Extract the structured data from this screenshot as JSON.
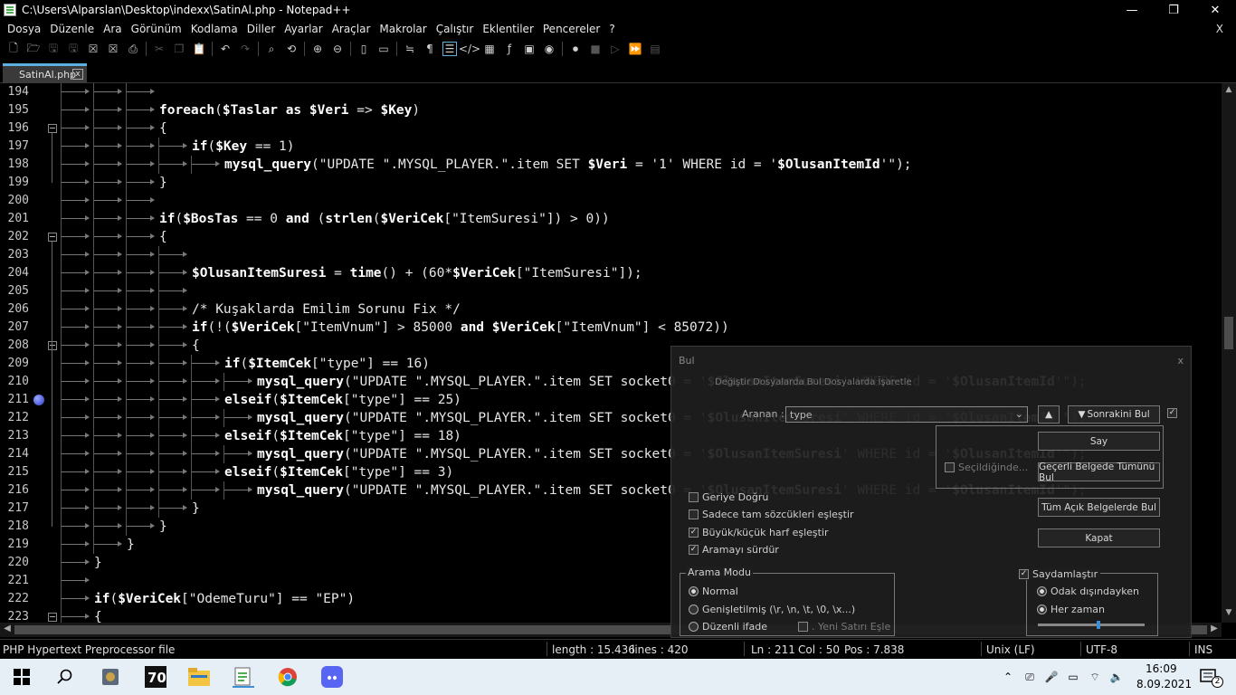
{
  "window": {
    "title": "C:\\Users\\Alparslan\\Desktop\\indexx\\SatinAl.php - Notepad++",
    "min": "—",
    "max": "❐",
    "close": "✕"
  },
  "menu": {
    "items": [
      "Dosya",
      "Düzenle",
      "Ara",
      "Görünüm",
      "Kodlama",
      "Diller",
      "Ayarlar",
      "Araçlar",
      "Makrolar",
      "Çalıştır",
      "Eklentiler",
      "Pencereler",
      "?"
    ],
    "close": "X"
  },
  "toolbar": {
    "icons": [
      "new-file-icon",
      "open-file-icon",
      "save-icon",
      "save-all-icon",
      "close-icon",
      "close-all-icon",
      "print-icon",
      "cut-icon",
      "copy-icon",
      "paste-icon",
      "undo-icon",
      "redo-icon",
      "find-icon",
      "replace-icon",
      "zoom-in-icon",
      "zoom-out-icon",
      "sync-vertical-icon",
      "sync-horizontal-icon",
      "word-wrap-icon",
      "show-all-chars-icon",
      "indent-guide-icon",
      "xml-icon",
      "doc-map-icon",
      "function-list-icon",
      "monitor-icon",
      "folder-workspace-icon",
      "record-macro-icon",
      "stop-macro-icon",
      "play-macro-icon",
      "run-macro-multiple-icon",
      "save-macro-icon"
    ]
  },
  "tab": {
    "label": "SatinAl.php",
    "close": "x"
  },
  "editor": {
    "lines": [
      {
        "n": "194",
        "indent": 3,
        "code": ""
      },
      {
        "n": "195",
        "indent": 3,
        "code": "foreach($Taslar as $Veri => $Key)"
      },
      {
        "n": "196",
        "indent": 3,
        "code": "{"
      },
      {
        "n": "197",
        "indent": 4,
        "code": "if($Key == 1)"
      },
      {
        "n": "198",
        "indent": 5,
        "code": "mysql_query(\"UPDATE \".MYSQL_PLAYER.\".item SET $Veri = '1' WHERE id = '$OlusanItemId'\");"
      },
      {
        "n": "199",
        "indent": 3,
        "code": "}"
      },
      {
        "n": "200",
        "indent": 3,
        "code": ""
      },
      {
        "n": "201",
        "indent": 3,
        "code": "if($BosTas == 0 and (strlen($VeriCek[\"ItemSuresi\"]) > 0))"
      },
      {
        "n": "202",
        "indent": 3,
        "code": "{"
      },
      {
        "n": "203",
        "indent": 4,
        "code": ""
      },
      {
        "n": "204",
        "indent": 4,
        "code": "$OlusanItemSuresi = time() + (60*$VeriCek[\"ItemSuresi\"]);"
      },
      {
        "n": "205",
        "indent": 4,
        "code": ""
      },
      {
        "n": "206",
        "indent": 4,
        "code": "/* Kuşaklarda Emilim Sorunu Fix */"
      },
      {
        "n": "207",
        "indent": 4,
        "code": "if(!($VeriCek[\"ItemVnum\"] > 85000 and $VeriCek[\"ItemVnum\"] < 85072))"
      },
      {
        "n": "208",
        "indent": 4,
        "code": "{"
      },
      {
        "n": "209",
        "indent": 5,
        "code": "if($ItemCek[\"type\"] == 16)"
      },
      {
        "n": "210",
        "indent": 6,
        "code": "mysql_query(\"UPDATE \".MYSQL_PLAYER.\".item SET socket0 = '$OlusanItemSuresi' WHERE id = '$OlusanItemId'\");"
      },
      {
        "n": "211",
        "indent": 5,
        "code": "elseif($ItemCek[\"type\"] == 25)"
      },
      {
        "n": "212",
        "indent": 6,
        "code": "mysql_query(\"UPDATE \".MYSQL_PLAYER.\".item SET socket0 = '$OlusanItemSuresi' WHERE id = '$OlusanItemId'\");"
      },
      {
        "n": "213",
        "indent": 5,
        "code": "elseif($ItemCek[\"type\"] == 18)"
      },
      {
        "n": "214",
        "indent": 6,
        "code": "mysql_query(\"UPDATE \".MYSQL_PLAYER.\".item SET socket0 = '$OlusanItemSuresi' WHERE id = '$OlusanItemId'\");"
      },
      {
        "n": "215",
        "indent": 5,
        "code": "elseif($ItemCek[\"type\"] == 3)"
      },
      {
        "n": "216",
        "indent": 6,
        "code": "mysql_query(\"UPDATE \".MYSQL_PLAYER.\".item SET socket0 = '$OlusanItemSuresi' WHERE id = '$OlusanItemId'\");"
      },
      {
        "n": "217",
        "indent": 4,
        "code": "}"
      },
      {
        "n": "218",
        "indent": 3,
        "code": "}"
      },
      {
        "n": "219",
        "indent": 2,
        "code": "}"
      },
      {
        "n": "220",
        "indent": 1,
        "code": "}"
      },
      {
        "n": "221",
        "indent": 1,
        "code": ""
      },
      {
        "n": "222",
        "indent": 1,
        "code": "if($VeriCek[\"OdemeTuru\"] == \"EP\")"
      },
      {
        "n": "223",
        "indent": 1,
        "code": "{"
      }
    ]
  },
  "find_dialog": {
    "title": "Bul",
    "close": "x",
    "tabs_ghost": "Değiştir  Dosyalarda Bul  Dosyalarda İşaretle",
    "search_label": "Aranan :",
    "search_value": "type",
    "find_next": "Sonrakini Bul",
    "count": "Say",
    "find_all_current": "Geçerli Belgede Tümünü Bul",
    "find_all_open": "Tüm Açık Belgelerde Bul",
    "close_btn": "Kapat",
    "in_selection": "Seçildiğinde...",
    "backward": "Geriye Doğru",
    "whole_word": "Sadece tam sözcükleri eşleştir",
    "match_case": "Büyük/küçük harf eşleştir",
    "wrap_around": "Aramayı sürdür",
    "search_mode_label": "Arama Modu",
    "mode_normal": "Normal",
    "mode_extended": "Genişletilmiş (\\r, \\n, \\t, \\0, \\x...)",
    "mode_regex": "Düzenli ifade",
    "newline_match": ". Yeni Satırı Eşle",
    "transparency_label": "Saydamlaştır",
    "on_lose_focus": "Odak dışındayken",
    "always": "Her zaman",
    "transparency_level": 0.55
  },
  "status": {
    "filetype": "PHP Hypertext Preprocessor file",
    "length": "length : 15.436",
    "lines": "lines : 420",
    "ln": "Ln : 211",
    "col": "Col : 50",
    "pos": "Pos : 7.838",
    "eol": "Unix (LF)",
    "encoding": "UTF-8",
    "ins": "INS"
  },
  "taskbar": {
    "time": "16:09",
    "date": "8.09.2021",
    "notifications": "2"
  }
}
